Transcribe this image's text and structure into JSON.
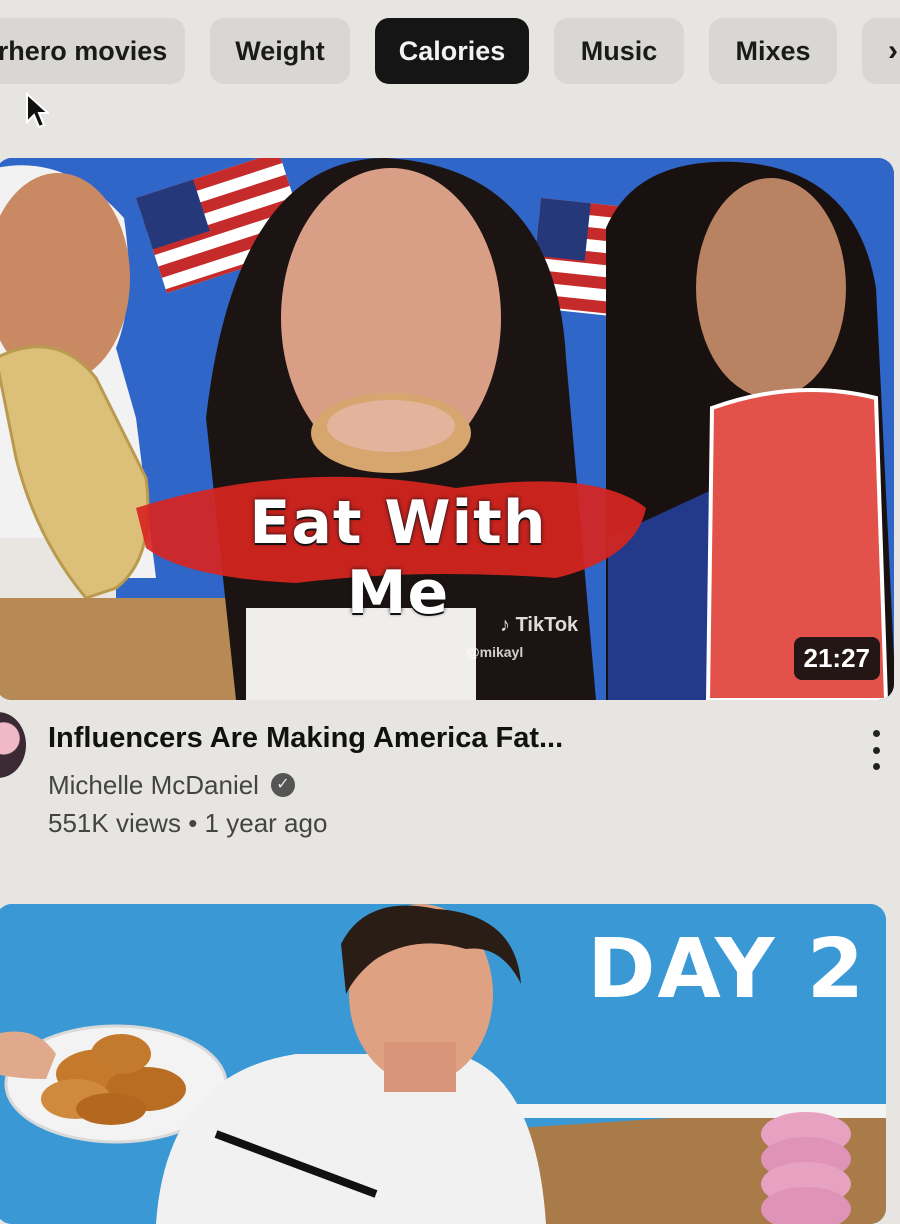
{
  "chips": [
    {
      "label": "rhero movies",
      "active": false
    },
    {
      "label": "Weight",
      "active": false
    },
    {
      "label": "Calories",
      "active": true
    },
    {
      "label": "Music",
      "active": false
    },
    {
      "label": "Mixes",
      "active": false
    }
  ],
  "chip_next_icon": "chevron-right-icon",
  "video1": {
    "thumbnail_caption": "Eat With Me",
    "watermark_brand": "TikTok",
    "watermark_handle": "@mikayl",
    "duration": "21:27",
    "title": "Influencers Are Making America Fat...",
    "channel": "Michelle McDaniel",
    "views": "551K views",
    "separator": "•",
    "age": "1 year ago"
  },
  "video2": {
    "thumbnail_caption": "DAY 2"
  },
  "colors": {
    "page_bg": "#e7e5e1",
    "chip_bg": "#d9d7d3",
    "chip_active_bg": "#151515",
    "thumb1_bg": "#2f66c8",
    "thumb2_bg": "#3a98d4",
    "caption_red": "#d8251f"
  }
}
